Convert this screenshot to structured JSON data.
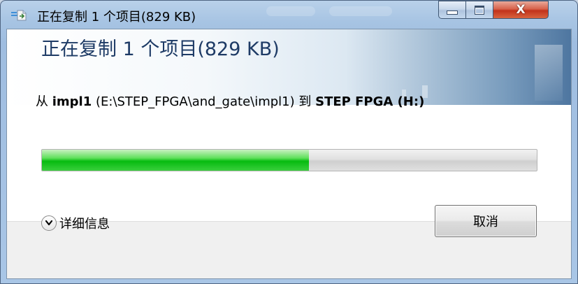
{
  "window": {
    "title": "正在复制 1 个项目(829 KB)",
    "close_glyph": "X"
  },
  "header": {
    "title": "正在复制 1 个项目(829 KB)"
  },
  "copy": {
    "from_word": "从",
    "source_name": "impl1",
    "source_path": "(E:\\STEP_FPGA\\and_gate\\impl1)",
    "to_word": "到",
    "destination": "STEP FPGA (H:)"
  },
  "progress": {
    "fraction": 0.54
  },
  "footer": {
    "details_label": "详细信息",
    "cancel_label": "取消"
  },
  "colors": {
    "progress_green": "#06bb10",
    "header_text": "#1e3b66",
    "close_red": "#c2321b"
  }
}
